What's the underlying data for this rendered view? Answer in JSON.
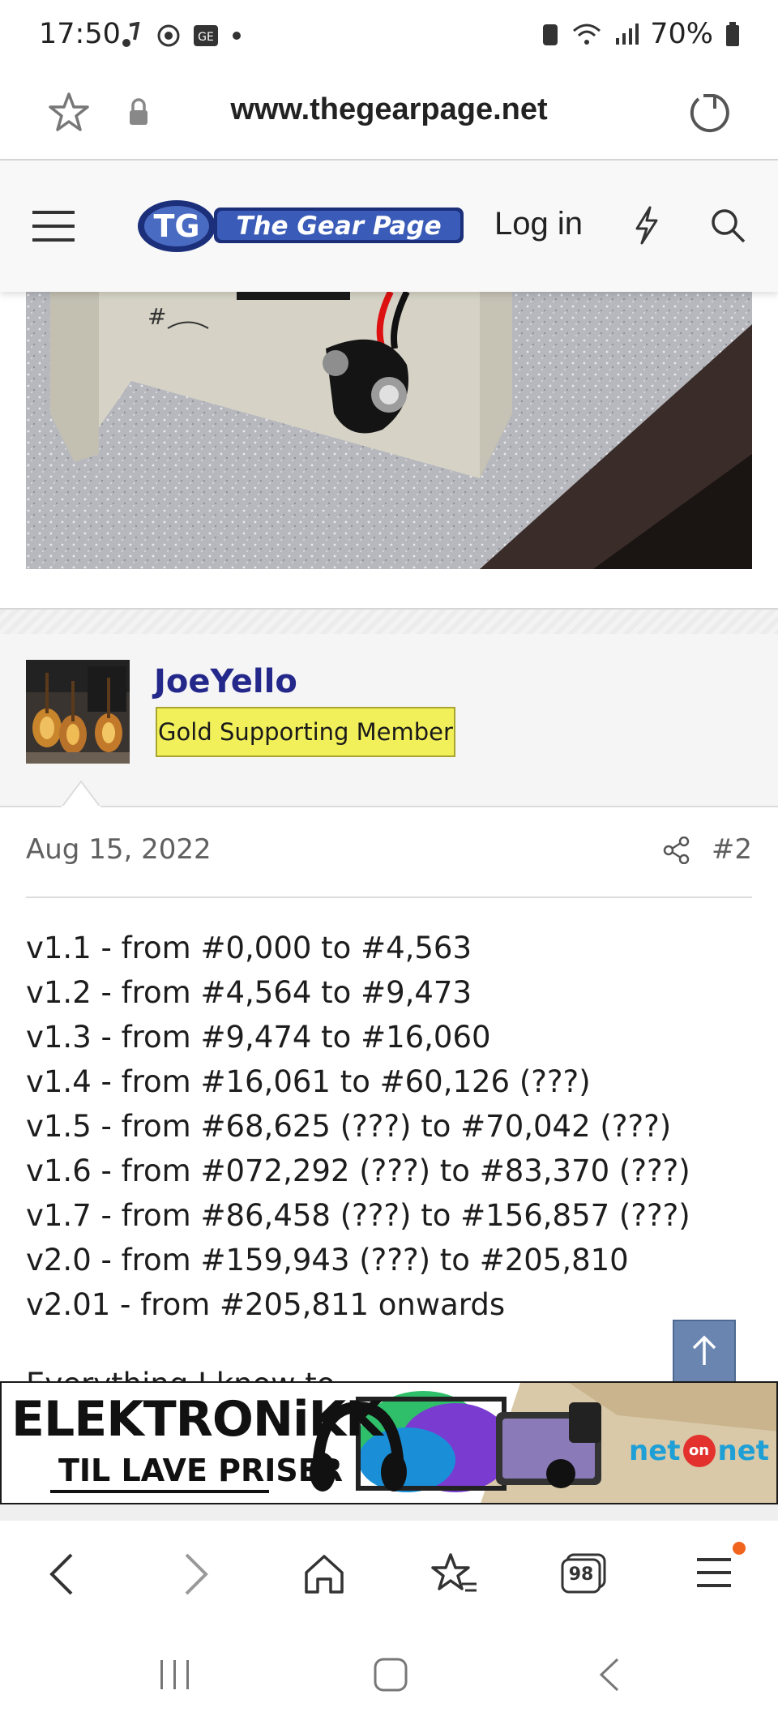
{
  "status_bar": {
    "time": "17:50",
    "battery": "70%"
  },
  "browser": {
    "url": "www.thegearpage.net"
  },
  "site": {
    "logo_text": "The Gear Page",
    "login_label": "Log in"
  },
  "post": {
    "username": "JoeYello",
    "badge": "Gold Supporting Member",
    "date": "Aug 15, 2022",
    "number": "#2",
    "lines": [
      "v1.1 - from #0,000 to #4,563",
      "v1.2 - from #4,564 to #9,473",
      "v1.3 - from #9,474 to #16,060",
      "v1.4 - from #16,061 to #60,126 (???)",
      "v1.5 - from #68,625 (???) to #70,042 (???)",
      "v1.6 - from #072,292 (???) to #83,370 (???)",
      "v1.7 - from #86,458 (???) to #156,857 (???)",
      "v2.0 - from #159,943 (???) to #205,810",
      "v2.01 - from #205,811 onwards"
    ],
    "cut_line": "Everything I know to"
  },
  "ad": {
    "headline": "ELEKTRONiKK",
    "subline": "TIL LAVE PRISER",
    "brand_left": "net",
    "brand_mid": "on",
    "brand_right": "net"
  },
  "bottom_bar": {
    "tabs_count": "98"
  },
  "colors": {
    "username": "#24288a",
    "badge_bg": "#f2f05a",
    "scroll_button": "#6a86b0",
    "brand_blue": "#1e9fd6",
    "brand_red": "#e3312d",
    "notify_dot": "#f0641e"
  }
}
